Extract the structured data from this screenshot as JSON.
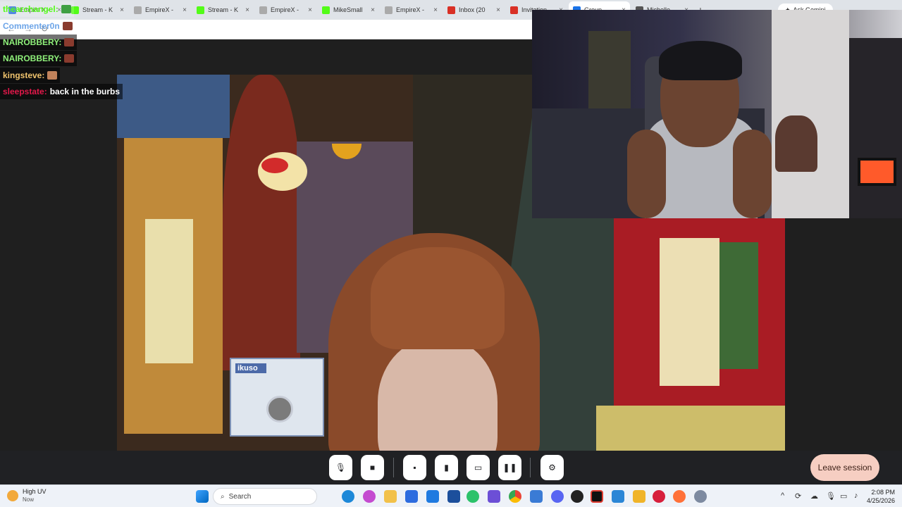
{
  "browser": {
    "tabs": [
      {
        "title": "Empire X -",
        "color": "#2d6cdf"
      },
      {
        "title": "Stream - K",
        "color": "#53fc18"
      },
      {
        "title": "EmpireX -",
        "color": "#aaaaaa"
      },
      {
        "title": "Stream - K",
        "color": "#53fc18"
      },
      {
        "title": "EmpireX -",
        "color": "#aaaaaa"
      },
      {
        "title": "MikeSmall",
        "color": "#53fc18"
      },
      {
        "title": "EmpireX -",
        "color": "#aaaaaa"
      },
      {
        "title": "Inbox (20",
        "color": "#d93025"
      },
      {
        "title": "Invitation",
        "color": "#d93025"
      },
      {
        "title": "Group",
        "color": "#1a73e8"
      },
      {
        "title": "Michelle",
        "color": "#555555"
      }
    ],
    "new_tab": "+",
    "gemini_label": "Ask Gemini"
  },
  "chat": {
    "messages": [
      {
        "user": "thearchangel:",
        "text": "",
        "color": "#53fc18"
      },
      {
        "user": "Commenter0n",
        "text": "",
        "color": "#6da5e8"
      },
      {
        "user": "NAIROBBERY:",
        "text": "",
        "color": "#8ff07a"
      },
      {
        "user": "NAIROBBERY:",
        "text": "",
        "color": "#8ff07a"
      },
      {
        "user": "kingsteve:",
        "text": "",
        "color": "#f0c36d"
      },
      {
        "user": "sleepstate:",
        "text": "back in the burbs",
        "color": "#e2184a"
      }
    ]
  },
  "video": {
    "box_label": "ikuso"
  },
  "controls": {
    "buttons": [
      {
        "name": "mic-button",
        "icon": "mic-icon",
        "glyph": "🎙"
      },
      {
        "name": "camera-button",
        "icon": "camera-icon",
        "glyph": "■"
      },
      {
        "name": "chat-button",
        "icon": "chat-icon",
        "glyph": "▪"
      },
      {
        "name": "clipboard-button",
        "icon": "clipboard-icon",
        "glyph": "▮"
      },
      {
        "name": "screen-share-button",
        "icon": "screen-share-icon",
        "glyph": "▭"
      },
      {
        "name": "pause-button",
        "icon": "pause-icon",
        "glyph": "❚❚"
      },
      {
        "name": "settings-button",
        "icon": "gear-icon",
        "glyph": "⚙"
      }
    ],
    "leave_label": "Leave session"
  },
  "taskbar": {
    "weather_title": "High UV",
    "weather_sub": "Now",
    "search_placeholder": "Search",
    "time": "2:08 PM",
    "date": "4/25/2026"
  }
}
